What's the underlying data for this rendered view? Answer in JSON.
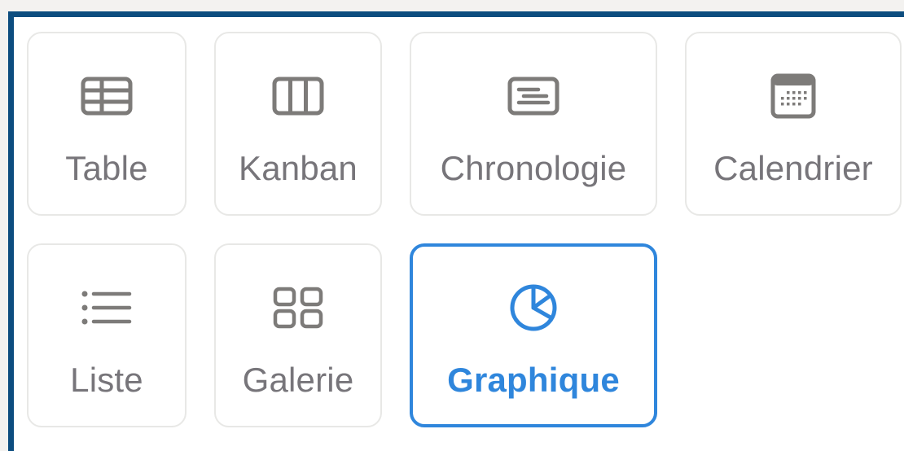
{
  "view_types": [
    {
      "id": "table",
      "label": "Table",
      "icon": "table-icon"
    },
    {
      "id": "kanban",
      "label": "Kanban",
      "icon": "kanban-columns-icon"
    },
    {
      "id": "chronologie",
      "label": "Chronologie",
      "icon": "timeline-icon"
    },
    {
      "id": "calendrier",
      "label": "Calendrier",
      "icon": "calendar-icon"
    },
    {
      "id": "liste",
      "label": "Liste",
      "icon": "list-icon"
    },
    {
      "id": "galerie",
      "label": "Galerie",
      "icon": "gallery-grid-icon"
    },
    {
      "id": "graphique",
      "label": "Graphique",
      "icon": "pie-chart-icon"
    }
  ],
  "selected": "graphique",
  "colors": {
    "accent": "#2f86dc",
    "frame_border": "#0d4d7f",
    "card_border": "#e8e8e6",
    "label_text": "#77757a",
    "icon": "#7d7b79",
    "background": "#f3f2f0"
  }
}
